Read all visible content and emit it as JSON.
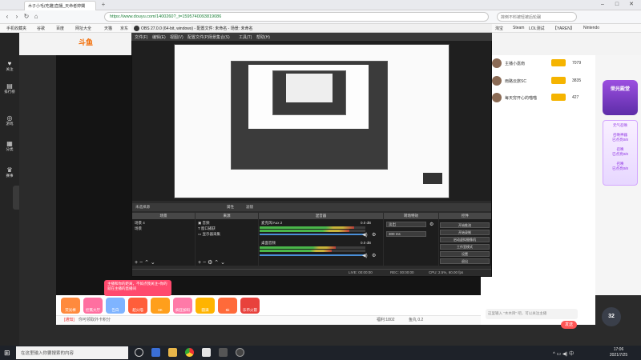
{
  "browser": {
    "tab_title": "木子小毛(吃雞)直播_天命者婷嫻",
    "tab_plus": "+",
    "url": "https://www.douyu.com/1400260?_t=1595740093819086",
    "search_placeholder": "摔倒不料被轻被后轮碾",
    "bookmarks": [
      "手机收藏夹",
      "谷歌",
      "百度",
      "网址大全",
      "天猫",
      "京东",
      "淘宝",
      "Steam",
      "LOL测试",
      "【YAREN】",
      "Nintendo"
    ],
    "win_controls": [
      "–",
      "□",
      "✕"
    ]
  },
  "douyu": {
    "logo": "斗鱼",
    "left_nav": [
      {
        "icon": "♥",
        "label": "关注"
      },
      {
        "icon": "▤",
        "label": "排行榜"
      },
      {
        "icon": "◎",
        "label": "游戏"
      },
      {
        "icon": "▦",
        "label": "分类"
      },
      {
        "icon": "♛",
        "label": "赛事"
      }
    ],
    "ranks": [
      {
        "name": "主播小嘉南",
        "score": "7079"
      },
      {
        "name": "雨路云旅SC",
        "score": "3835"
      },
      {
        "name": "每天穷开心的喵喵",
        "score": "427"
      }
    ],
    "promo_title": "荣光殿堂",
    "promo2_lines": [
      "元气召唤",
      "召唤神器",
      "已点亮0/8",
      "召唤",
      "已点亮0/8",
      "召唤",
      "已点亮0/8"
    ],
    "toast": "主播和你的距离，不如点我关注+你的就在主播的直播间",
    "gifts": [
      "荧光棒",
      "控氯大厅",
      "告白",
      "超火喵",
      "8K",
      "疯狂加码",
      "圆满",
      "5k",
      "乐币火箭"
    ],
    "bottom_left": "[通知]",
    "bottom_text": "你可领取外卡积分",
    "bottom_right": [
      "福利:1802",
      "鱼丸 0.2"
    ],
    "chat_placeholder": "这里输入 \"木木目\" 吧，可以关注主播",
    "send": "发送",
    "timer": "32"
  },
  "obs": {
    "title": "OBS 27.0.0 (64-bit, windows) - 配置文件: 未命名 - 场景: 未命名",
    "menu": [
      "文件(F)",
      "编辑(E)",
      "视图(V)",
      "配置文件(P)",
      "场景集合(S)",
      "工具(T)",
      "帮助(H)"
    ],
    "scenes_label": "未选择源",
    "props_btns": [
      "属性",
      "滤镜"
    ],
    "panels": {
      "scenes": "场景",
      "sources": "来源",
      "mixer": "混音器",
      "transitions": "转场特效",
      "controls": "控件"
    },
    "scene_items": [
      "场景 4",
      "场景"
    ],
    "source_items": [
      "音频",
      "窗口捕获",
      "显示器采集"
    ],
    "mixer_tracks": [
      {
        "name": "麦克风/Aux 2",
        "db": "0.0 dB"
      },
      {
        "name": "桌面音频",
        "db": "0.0 dB"
      }
    ],
    "transition_value": "淡出",
    "duration": "300 ms",
    "controls": [
      "开始推流",
      "开始录制",
      "启动虚拟摄像机",
      "工作室模式",
      "设置",
      "退出"
    ],
    "status": {
      "live": "LIVE: 00:00:00",
      "rec": "REC: 00:00:00",
      "cpu": "CPU: 2.5%, 60.00 fps"
    }
  },
  "taskbar": {
    "search_placeholder": "在这里输入你要搜索的内容",
    "time": "17:06",
    "date": "2021/7/25"
  }
}
